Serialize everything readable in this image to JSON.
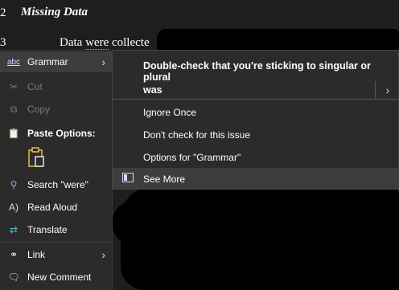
{
  "document": {
    "heading_number": "2",
    "heading": "Missing Data",
    "line_number": "3",
    "text_before": "Data ",
    "text_error": "were",
    "text_after": " collecte"
  },
  "context_menu": {
    "items": [
      {
        "label": "Grammar",
        "icon": "abc",
        "has_submenu": true,
        "state": "active"
      },
      {
        "label": "Cut",
        "icon": "scissors-icon",
        "state": "disabled"
      },
      {
        "label": "Copy",
        "icon": "copy-icon",
        "state": "disabled"
      },
      {
        "label": "Paste Options:",
        "icon": "clipboard-icon",
        "state": "normal"
      },
      {
        "label": "Search \"were\"",
        "icon": "search-icon",
        "state": "normal"
      },
      {
        "label": "Read Aloud",
        "icon": "speaker-icon",
        "state": "normal"
      },
      {
        "label": "Translate",
        "icon": "translate-icon",
        "state": "normal"
      },
      {
        "label": "Link",
        "icon": "link-icon",
        "has_submenu": true,
        "state": "normal"
      },
      {
        "label": "New Comment",
        "icon": "comment-icon",
        "state": "normal"
      }
    ]
  },
  "grammar_submenu": {
    "header": "Double-check that you're sticking to singular or plural",
    "suggestion": "was",
    "items": [
      {
        "label": "Ignore Once"
      },
      {
        "label": "Don't check for this issue"
      },
      {
        "label": "Options for \"Grammar\""
      },
      {
        "label": "See More"
      }
    ]
  },
  "colors": {
    "menu_bg": "#2b2b2b",
    "hover_bg": "#3d3d3d",
    "accent": "#9aa4ff",
    "disabled_text": "#7a7a7a"
  }
}
